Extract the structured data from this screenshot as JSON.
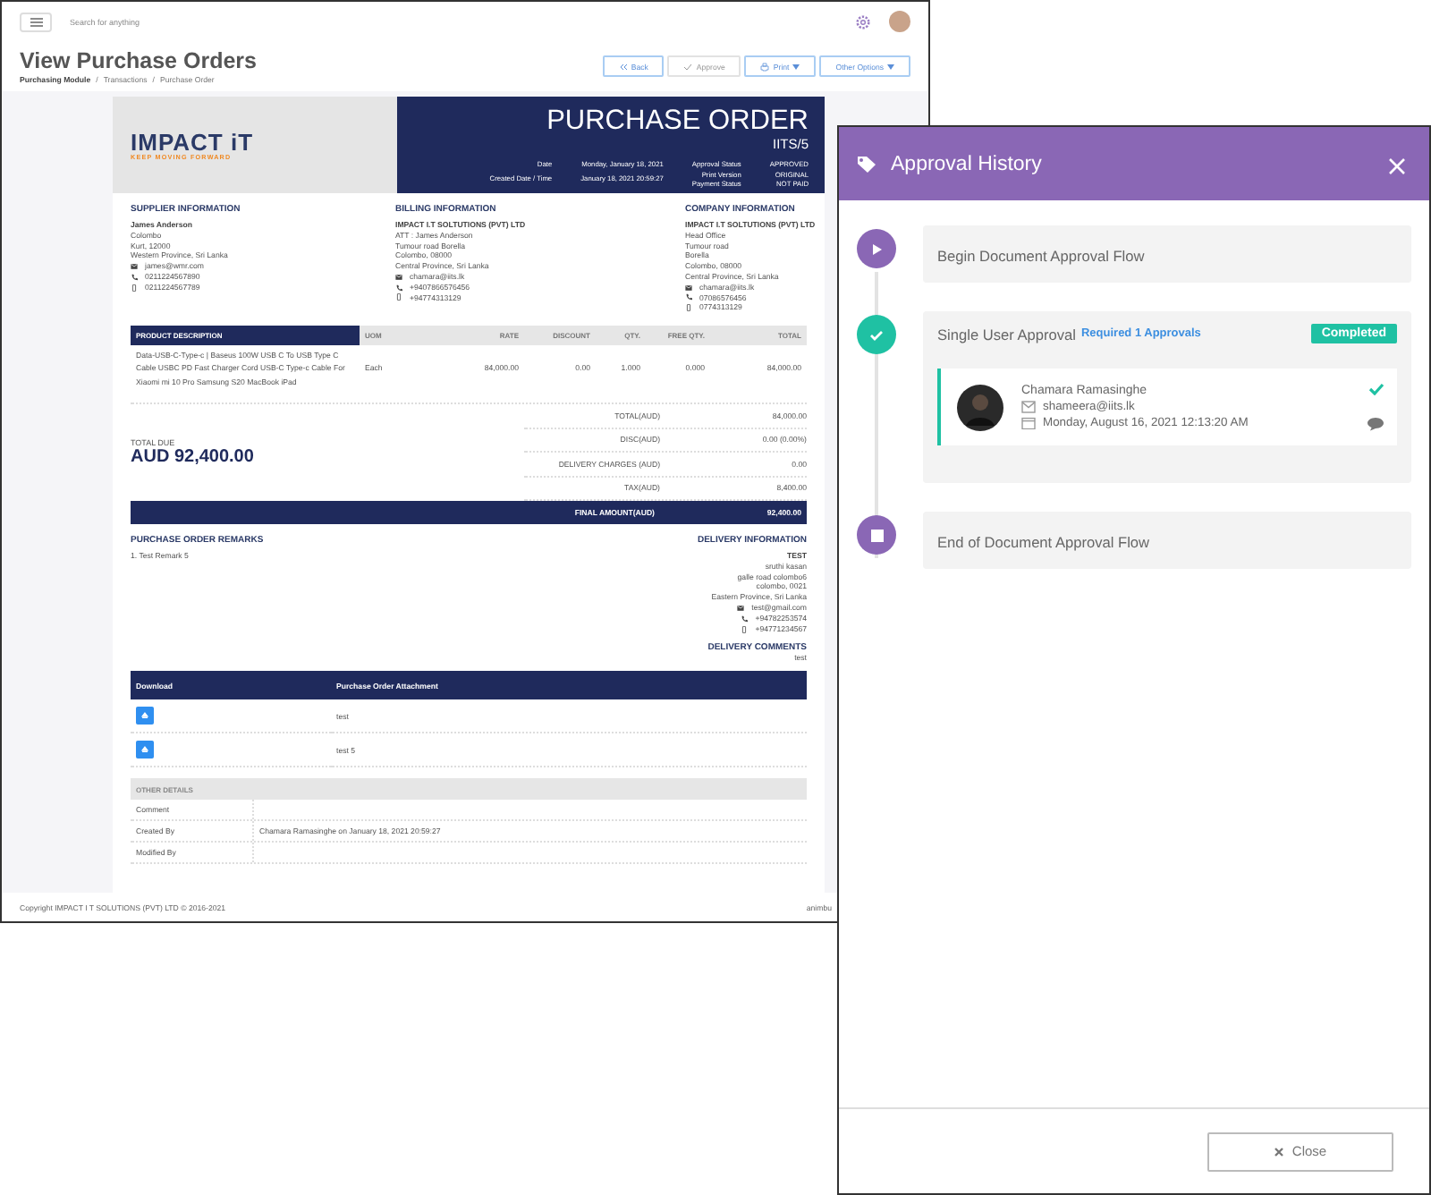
{
  "topbar": {
    "search_placeholder": "Search for anything"
  },
  "page": {
    "title": "View Purchase Orders",
    "breadcrumb": [
      "Purchasing Module",
      "Transactions",
      "Purchase Order"
    ],
    "breadcrumb_separator": "/",
    "actions": [
      {
        "label": "Back",
        "kind": "back",
        "disabled": false,
        "dropdown": false
      },
      {
        "label": "Approve",
        "kind": "approve",
        "disabled": true,
        "dropdown": false
      },
      {
        "label": "Print",
        "kind": "print",
        "disabled": false,
        "dropdown": true
      },
      {
        "label": "Other Options",
        "kind": "options",
        "disabled": false,
        "dropdown": true
      }
    ]
  },
  "document": {
    "logo": {
      "name": "IMPACT iT",
      "tagline": "KEEP MOVING FORWARD"
    },
    "title": "PURCHASE ORDER",
    "number": "IITS/5",
    "meta_left": [
      {
        "label": "Date",
        "value": "Monday, January 18, 2021"
      },
      {
        "label": "Created Date / Time",
        "value": "January 18, 2021 20:59:27"
      }
    ],
    "meta_right": [
      {
        "label": "Approval Status",
        "value": "APPROVED"
      },
      {
        "label": "Print Version",
        "value": "ORIGINAL"
      },
      {
        "label": "Payment Status",
        "value": "NOT PAID"
      }
    ],
    "info": [
      {
        "heading": "SUPPLIER INFORMATION",
        "name": "James Anderson",
        "lines": [
          "Colombo",
          "Kurt, 12000",
          "Western Province, Sri Lanka"
        ],
        "contacts": [
          {
            "kind": "email",
            "text": "james@wmr.com"
          },
          {
            "kind": "phone",
            "text": "0211224567890"
          },
          {
            "kind": "mobile",
            "text": "0211224567789"
          }
        ]
      },
      {
        "heading": "BILLING INFORMATION",
        "name": "IMPACT I.T SOLTUTIONS (PVT) LTD",
        "lines": [
          "ATT : James Anderson",
          "Tumour road Borella",
          "Colombo, 08000",
          "Central Province, Sri Lanka"
        ],
        "contacts": [
          {
            "kind": "email",
            "text": "chamara@iits.lk"
          },
          {
            "kind": "phone",
            "text": "+9407866576456"
          },
          {
            "kind": "mobile",
            "text": "+94774313129"
          }
        ]
      },
      {
        "heading": "COMPANY INFORMATION",
        "name": "IMPACT I.T SOLTUTIONS (PVT) LTD",
        "lines": [
          "Head Office",
          "Tumour road",
          "Borella",
          "Colombo, 08000",
          "Central Province, Sri Lanka"
        ],
        "contacts": [
          {
            "kind": "email",
            "text": "chamara@iits.lk"
          },
          {
            "kind": "phone",
            "text": "07086576456"
          },
          {
            "kind": "mobile",
            "text": "0774313129"
          }
        ]
      }
    ],
    "items_table": {
      "columns": [
        "PRODUCT DESCRIPTION",
        "UOM",
        "RATE",
        "DISCOUNT",
        "QTY.",
        "FREE QTY.",
        "TOTAL"
      ],
      "rows": [
        [
          "Data-USB-C-Type-c | Baseus 100W USB C To USB Type C Cable USBC PD Fast Charger Cord USB-C Type-c Cable For Xiaomi mi 10 Pro Samsung S20 MacBook iPad",
          "Each",
          "84,000.00",
          "0.00",
          "1.000",
          "0.000",
          "84,000.00"
        ]
      ]
    },
    "total_due": {
      "label": "TOTAL DUE",
      "amount": "AUD 92,400.00"
    },
    "totals": [
      {
        "label": "TOTAL(AUD)",
        "value": "84,000.00"
      },
      {
        "label": "DISC(AUD)",
        "value": "0.00 (0.00%)"
      },
      {
        "label": "DELIVERY CHARGES (AUD)",
        "value": "0.00"
      },
      {
        "label": "TAX(AUD)",
        "value": "8,400.00"
      }
    ],
    "final": {
      "label": "FINAL AMOUNT(AUD)",
      "value": "92,400.00"
    },
    "remarks": {
      "heading": "PURCHASE ORDER REMARKS",
      "lines": [
        "1. Test Remark 5"
      ]
    },
    "delivery": {
      "heading": "DELIVERY INFORMATION",
      "name": "TEST",
      "lines": [
        "sruthi kasan",
        "galle road colombo6",
        "colombo, 0021",
        "Eastern Province, Sri Lanka"
      ],
      "contacts": [
        {
          "kind": "email",
          "text": "test@gmail.com"
        },
        {
          "kind": "phone",
          "text": "+94782253574"
        },
        {
          "kind": "mobile",
          "text": "+94771234567"
        }
      ],
      "comments_heading": "DELIVERY COMMENTS",
      "comments": "test"
    },
    "attachments": {
      "columns": [
        "Download",
        "Purchase Order Attachment"
      ],
      "rows": [
        "test",
        "test 5"
      ]
    },
    "other_details": {
      "heading": "OTHER DETAILS",
      "rows": [
        {
          "label": "Comment"
        },
        {
          "label": "Created By",
          "value": "Chamara Ramasinghe on January 18, 2021 20:59:27"
        },
        {
          "label": "Modified By"
        }
      ]
    }
  },
  "footer": {
    "copyright": "Copyright IMPACT I T SOLUTIONS (PVT) LTD © 2016-2021",
    "right": "animbu"
  },
  "approval_panel": {
    "title": "Approval History",
    "steps": [
      {
        "kind": "start",
        "title": "Begin Document Approval Flow"
      },
      {
        "kind": "approval",
        "title": "Single User Approval",
        "requirement": "Required 1 Approvals",
        "status": "Completed",
        "approvers": [
          {
            "name": "Chamara Ramasinghe",
            "email": "shameera@iits.lk",
            "date": "Monday, August 16, 2021 12:13:20 AM",
            "approved": true
          }
        ]
      },
      {
        "kind": "end",
        "title": "End of Document Approval Flow"
      }
    ],
    "close_label": "Close"
  }
}
